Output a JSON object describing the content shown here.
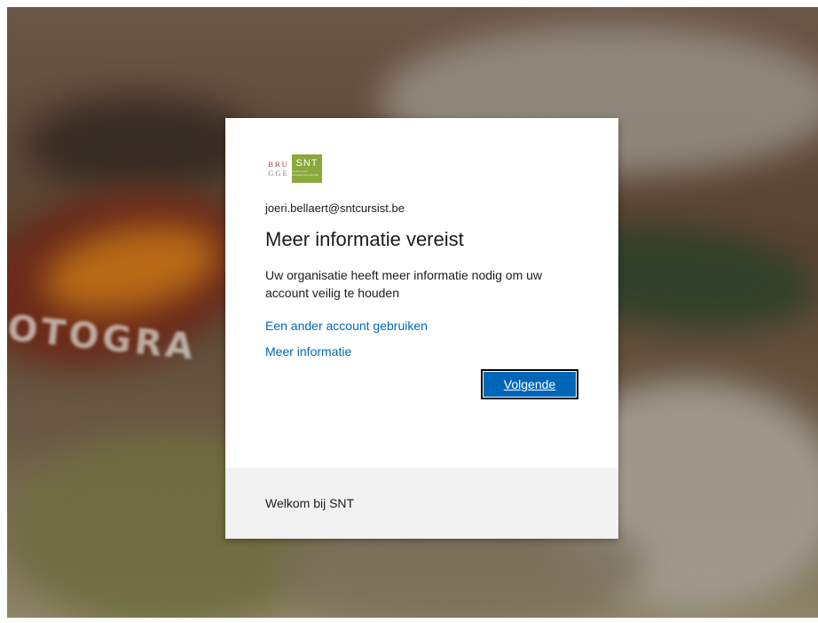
{
  "logo": {
    "left_line1": "BRU",
    "left_line2": "GGE",
    "right_text": "SNT",
    "right_subtext": "centrum voor volwassenenonderwijs"
  },
  "account": {
    "email": "joeri.bellaert@sntcursist.be"
  },
  "dialog": {
    "title": "Meer informatie vereist",
    "description": "Uw organisatie heeft meer informatie nodig om uw account veilig te houden",
    "link_other_account": "Een ander account gebruiken",
    "link_more_info": "Meer informatie",
    "next_button": "Volgende"
  },
  "footer": {
    "text": "Welkom bij SNT"
  },
  "background": {
    "photo_text": "OTOGRA"
  },
  "colors": {
    "accent": "#0067b8",
    "logo_green": "#8aa83b",
    "logo_red": "#b03038",
    "footer_bg": "#f2f2f2"
  }
}
